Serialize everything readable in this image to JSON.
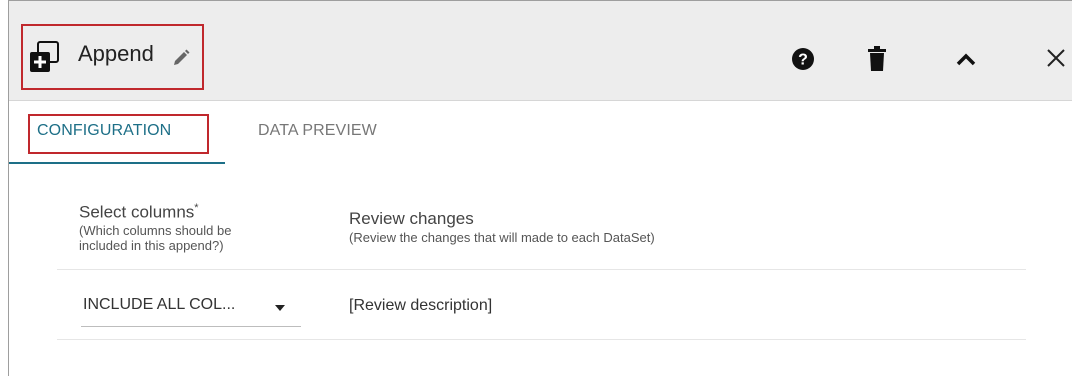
{
  "header": {
    "title": "Append",
    "icons": {
      "node": "append-node-icon",
      "edit": "pencil-icon",
      "help": "help-icon",
      "delete": "trash-icon",
      "collapse": "chevron-up-icon",
      "close": "close-icon"
    }
  },
  "tabs": [
    {
      "label": "CONFIGURATION",
      "active": true
    },
    {
      "label": "DATA PREVIEW",
      "active": false
    }
  ],
  "columns": {
    "select": {
      "title": "Select columns",
      "required_mark": "*",
      "subtitle_line1": "(Which columns should be",
      "subtitle_line2": "included in this append?)"
    },
    "review": {
      "title": "Review changes",
      "subtitle": "(Review the changes that will made to each DataSet)"
    }
  },
  "row": {
    "select_value": "INCLUDE ALL COL...",
    "review_description": "[Review description]"
  },
  "colors": {
    "accent": "#1d6f87",
    "highlight_border": "#c0282d",
    "header_bg": "#ededed"
  }
}
